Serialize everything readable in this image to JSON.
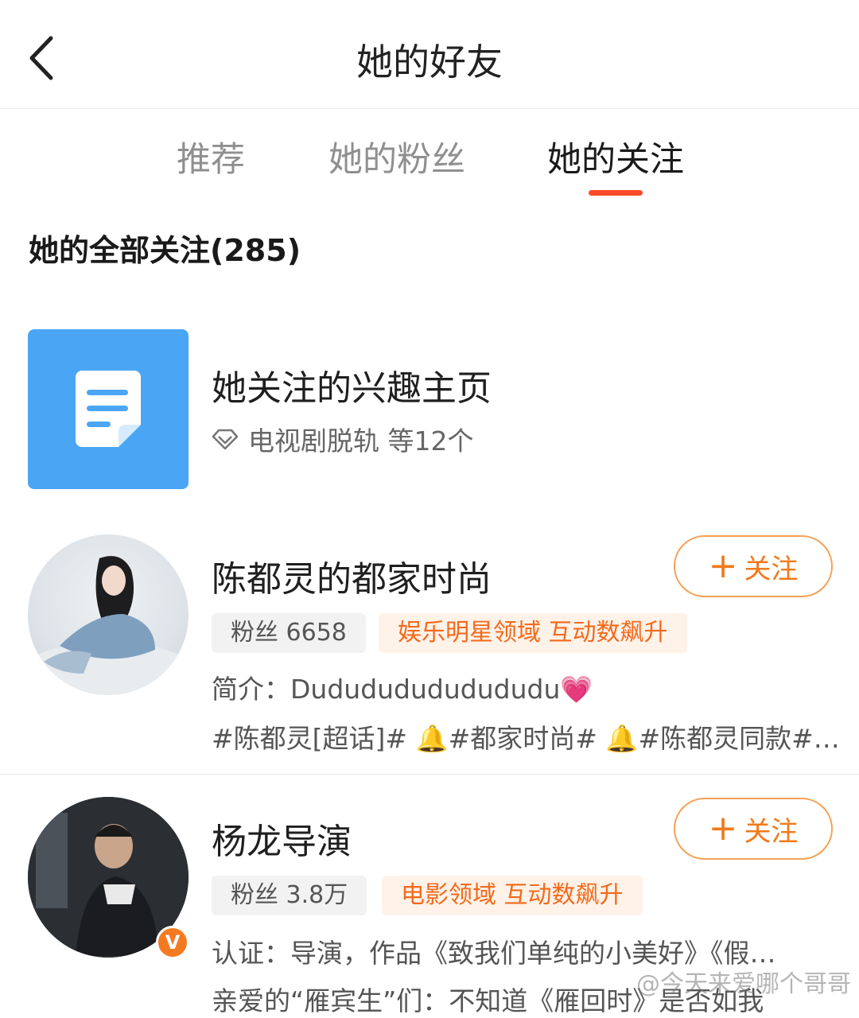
{
  "header": {
    "title": "她的好友",
    "back_icon": "chevron-left-icon"
  },
  "tabs": [
    {
      "label": "推荐",
      "active": false
    },
    {
      "label": "她的粉丝",
      "active": false
    },
    {
      "label": "她的关注",
      "active": true
    }
  ],
  "accent_color": "#ff4a2a",
  "section_title": "她的全部关注(285)",
  "interest": {
    "title": "她关注的兴趣主页",
    "icon": "document-icon",
    "sub_icon": "diamond-icon",
    "subtitle": "电视剧脱轨 等12个"
  },
  "users": [
    {
      "name": "陈都灵的都家时尚",
      "follow_label": "关注",
      "fans": "粉丝 6658",
      "tag": "娱乐明星领域 互动数飙升",
      "desc": "简介：Dudududududududu💗",
      "desc2": "#陈都灵[超话]# 🔔#都家时尚# 🔔#陈都灵同款#…"
    },
    {
      "name": "杨龙导演",
      "follow_label": "关注",
      "fans": "粉丝 3.8万",
      "tag": "电影领域 互动数飙升",
      "verified_label": "V",
      "desc": "认证：导演，作品《致我们单纯的小美好》《假…",
      "desc2": "亲爱的“雁宾生”们：不知道《雁回时》是否如我"
    }
  ],
  "watermark": "@今天来爱哪个哥哥"
}
